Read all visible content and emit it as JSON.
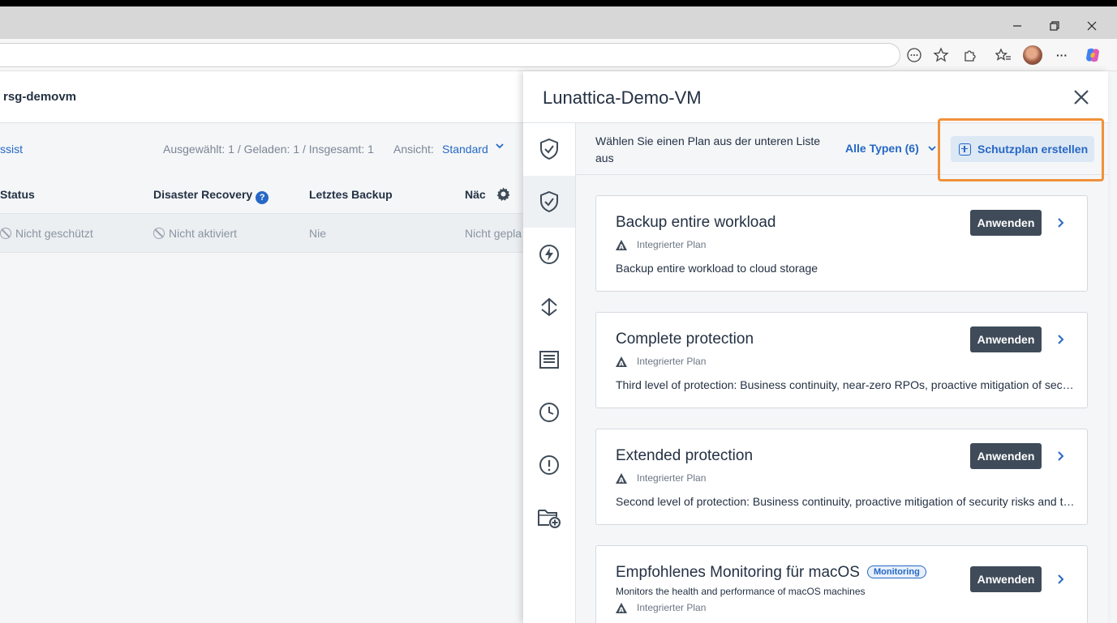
{
  "browser": {
    "window_controls": {
      "minimize": "–",
      "restore": "❐",
      "close": "✕"
    },
    "toolbar_icons": [
      "reader-icon",
      "favorite-star-icon",
      "extensions-icon",
      "favorites-icon",
      "profile-avatar",
      "more-icon",
      "copilot-icon"
    ],
    "more_label": "···"
  },
  "app": {
    "title": "rsg-demovm",
    "assist_link": "ssist",
    "counts": "Ausgewählt: 1 / Geladen: 1 / Insgesamt: 1",
    "view_label": "Ansicht:",
    "view_value": "Standard",
    "columns": [
      "Status",
      "Disaster Recovery",
      "Letztes Backup",
      "Näc"
    ],
    "help_badge": "?",
    "row": {
      "status": "Nicht geschützt",
      "disaster_recovery": "Nicht aktiviert",
      "last_backup": "Nie",
      "next": "Nicht gepla"
    }
  },
  "panel": {
    "title": "Lunattica-Demo-VM",
    "subheader_text": "Wählen Sie einen Plan aus der unteren Liste aus",
    "types_filter": "Alle Typen (6)",
    "create_button": "Schutzplan erstellen",
    "rail_icons": [
      "shield-check-icon",
      "shield-check-icon",
      "lightning-icon",
      "recovery-icon",
      "document-icon",
      "clock-icon",
      "alert-icon",
      "folder-add-icon"
    ],
    "plans": [
      {
        "title": "Backup entire workload",
        "meta": "Integrierter Plan",
        "description": "Backup entire workload to cloud storage",
        "apply": "Anwenden"
      },
      {
        "title": "Complete protection",
        "meta": "Integrierter Plan",
        "description": "Third level of protection: Business continuity, near-zero RPOs, proactive mitigation of security risks and threats",
        "apply": "Anwenden"
      },
      {
        "title": "Extended protection",
        "meta": "Integrierter Plan",
        "description": "Second level of protection: Business continuity, proactive mitigation of security risks and threats",
        "apply": "Anwenden"
      },
      {
        "title": "Empfohlenes Monitoring für macOS",
        "tag": "Monitoring",
        "subtitle": "Monitors the health and performance of macOS machines",
        "meta": "Integrierter Plan",
        "apply": "Anwenden"
      }
    ]
  },
  "colors": {
    "accent": "#2668c5",
    "highlight": "#f0913a",
    "apply_button": "#3f4b59"
  }
}
